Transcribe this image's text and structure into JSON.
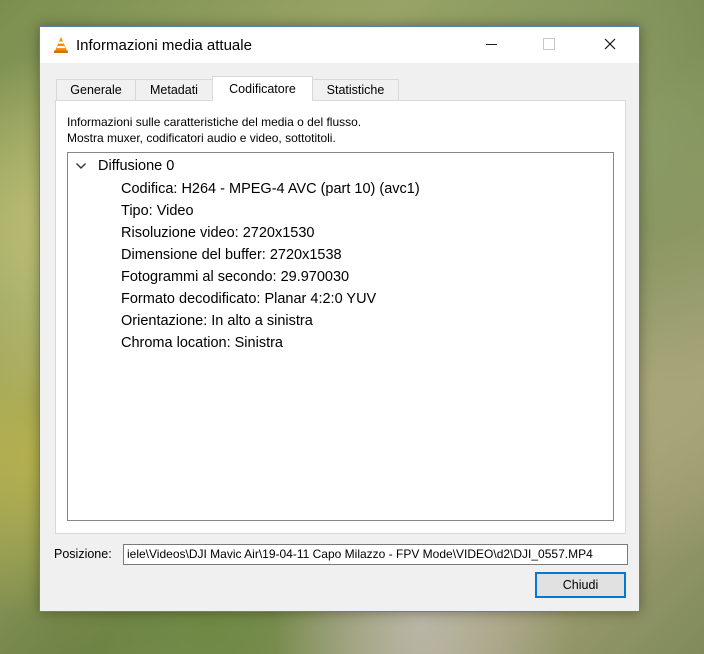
{
  "window": {
    "title": "Informazioni media attuale",
    "icon": "vlc-cone-icon"
  },
  "tabs": [
    {
      "label": "Generale",
      "active": false
    },
    {
      "label": "Metadati",
      "active": false
    },
    {
      "label": "Codificatore",
      "active": true
    },
    {
      "label": "Statistiche",
      "active": false
    }
  ],
  "panel": {
    "description_line1": "Informazioni sulle caratteristiche del media o del flusso.",
    "description_line2": "Mostra muxer, codificatori audio e video, sottotitoli.",
    "tree": {
      "root_label": "Diffusione 0",
      "expanded": true,
      "items": [
        "Codifica: H264 - MPEG-4 AVC (part 10) (avc1)",
        "Tipo: Video",
        "Risoluzione video: 2720x1530",
        "Dimensione del buffer: 2720x1538",
        "Fotogrammi al secondo: 29.970030",
        "Formato decodificato: Planar 4:2:0 YUV",
        "Orientazione: In alto a sinistra",
        "Chroma location: Sinistra"
      ]
    }
  },
  "position": {
    "label": "Posizione:",
    "value": "iele\\Videos\\DJI  Mavic  Air\\19-04-11 Capo Milazzo - FPV Mode\\VIDEO\\d2\\DJI_0557.MP4"
  },
  "buttons": {
    "close_label": "Chiudi"
  },
  "colors": {
    "accent": "#0078d7",
    "vlc_orange": "#f28c00"
  }
}
